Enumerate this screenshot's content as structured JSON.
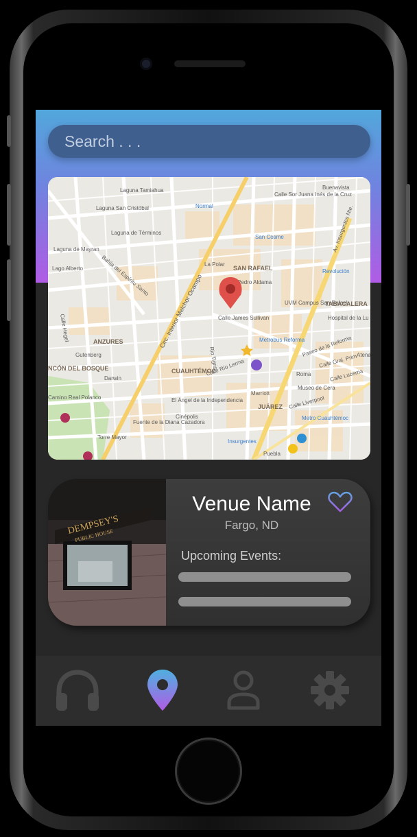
{
  "search": {
    "placeholder": "Search . . ."
  },
  "map": {
    "labels": [
      "Buenavista",
      "Laguna Tamiahua",
      "Laguna San Cristóbal",
      "Normal",
      "Calle Sor Juana Inés de la Cruz",
      "Av. Insurgentes Nte.",
      "Laguna de Términos",
      "San Cosme",
      "Laguna de Mayran",
      "La Polar",
      "SAN RAFAEL",
      "Revolución",
      "Lago Alberto",
      "Bahía del Espíritu Santo",
      "Pedro Aldama",
      "UVM Campus San Rafael",
      "TABACALERA",
      "Calle James Sullivan",
      "Hospital de la Lu",
      "ANZURES",
      "Calle Hegel",
      "Metrobus Reforma",
      "Paseo de la Reforma",
      "Gutenberg",
      "Circ. Interior Melchor Ocampo",
      "Rio Tigris",
      "CUAUHTÉMOC",
      "Calle Río Lerma",
      "Calle Gral. Prim",
      "NCÓN DEL BOSQUE",
      "Darwin",
      "Calle Lucerna",
      "Camino Real Polanco",
      "Marriott",
      "Museo de Cera",
      "El Ángel de la Independencia",
      "JUÁREZ",
      "Cinépolis",
      "Calle Liverpool",
      "Fuente de la Diana Cazadora",
      "Metro Cuauhtémoc",
      "Torre Mayor",
      "Insurgentes",
      "Puebla",
      "Roma",
      "Atenas"
    ]
  },
  "venue": {
    "name": "Venue Name",
    "city": "Fargo, ND",
    "events_label": "Upcoming Events:",
    "photo_sign_line1": "DEMPSEY'S",
    "photo_sign_line2": "PUBLIC HOUSE"
  },
  "nav": {
    "items": [
      {
        "icon": "headphones-icon",
        "active": false
      },
      {
        "icon": "map-pin-icon",
        "active": true
      },
      {
        "icon": "user-icon",
        "active": false
      },
      {
        "icon": "gear-icon",
        "active": false
      }
    ]
  },
  "colors": {
    "gradient_top": "#52a7dc",
    "gradient_bottom": "#b05ce4",
    "search_bg": "#3f5f8f",
    "screen_bg": "#272727",
    "card_bg": "#3a3a3a",
    "nav_bg": "#2d2d2d",
    "map_pin": "#e0504a",
    "inactive_icon": "#4a4a4a"
  }
}
